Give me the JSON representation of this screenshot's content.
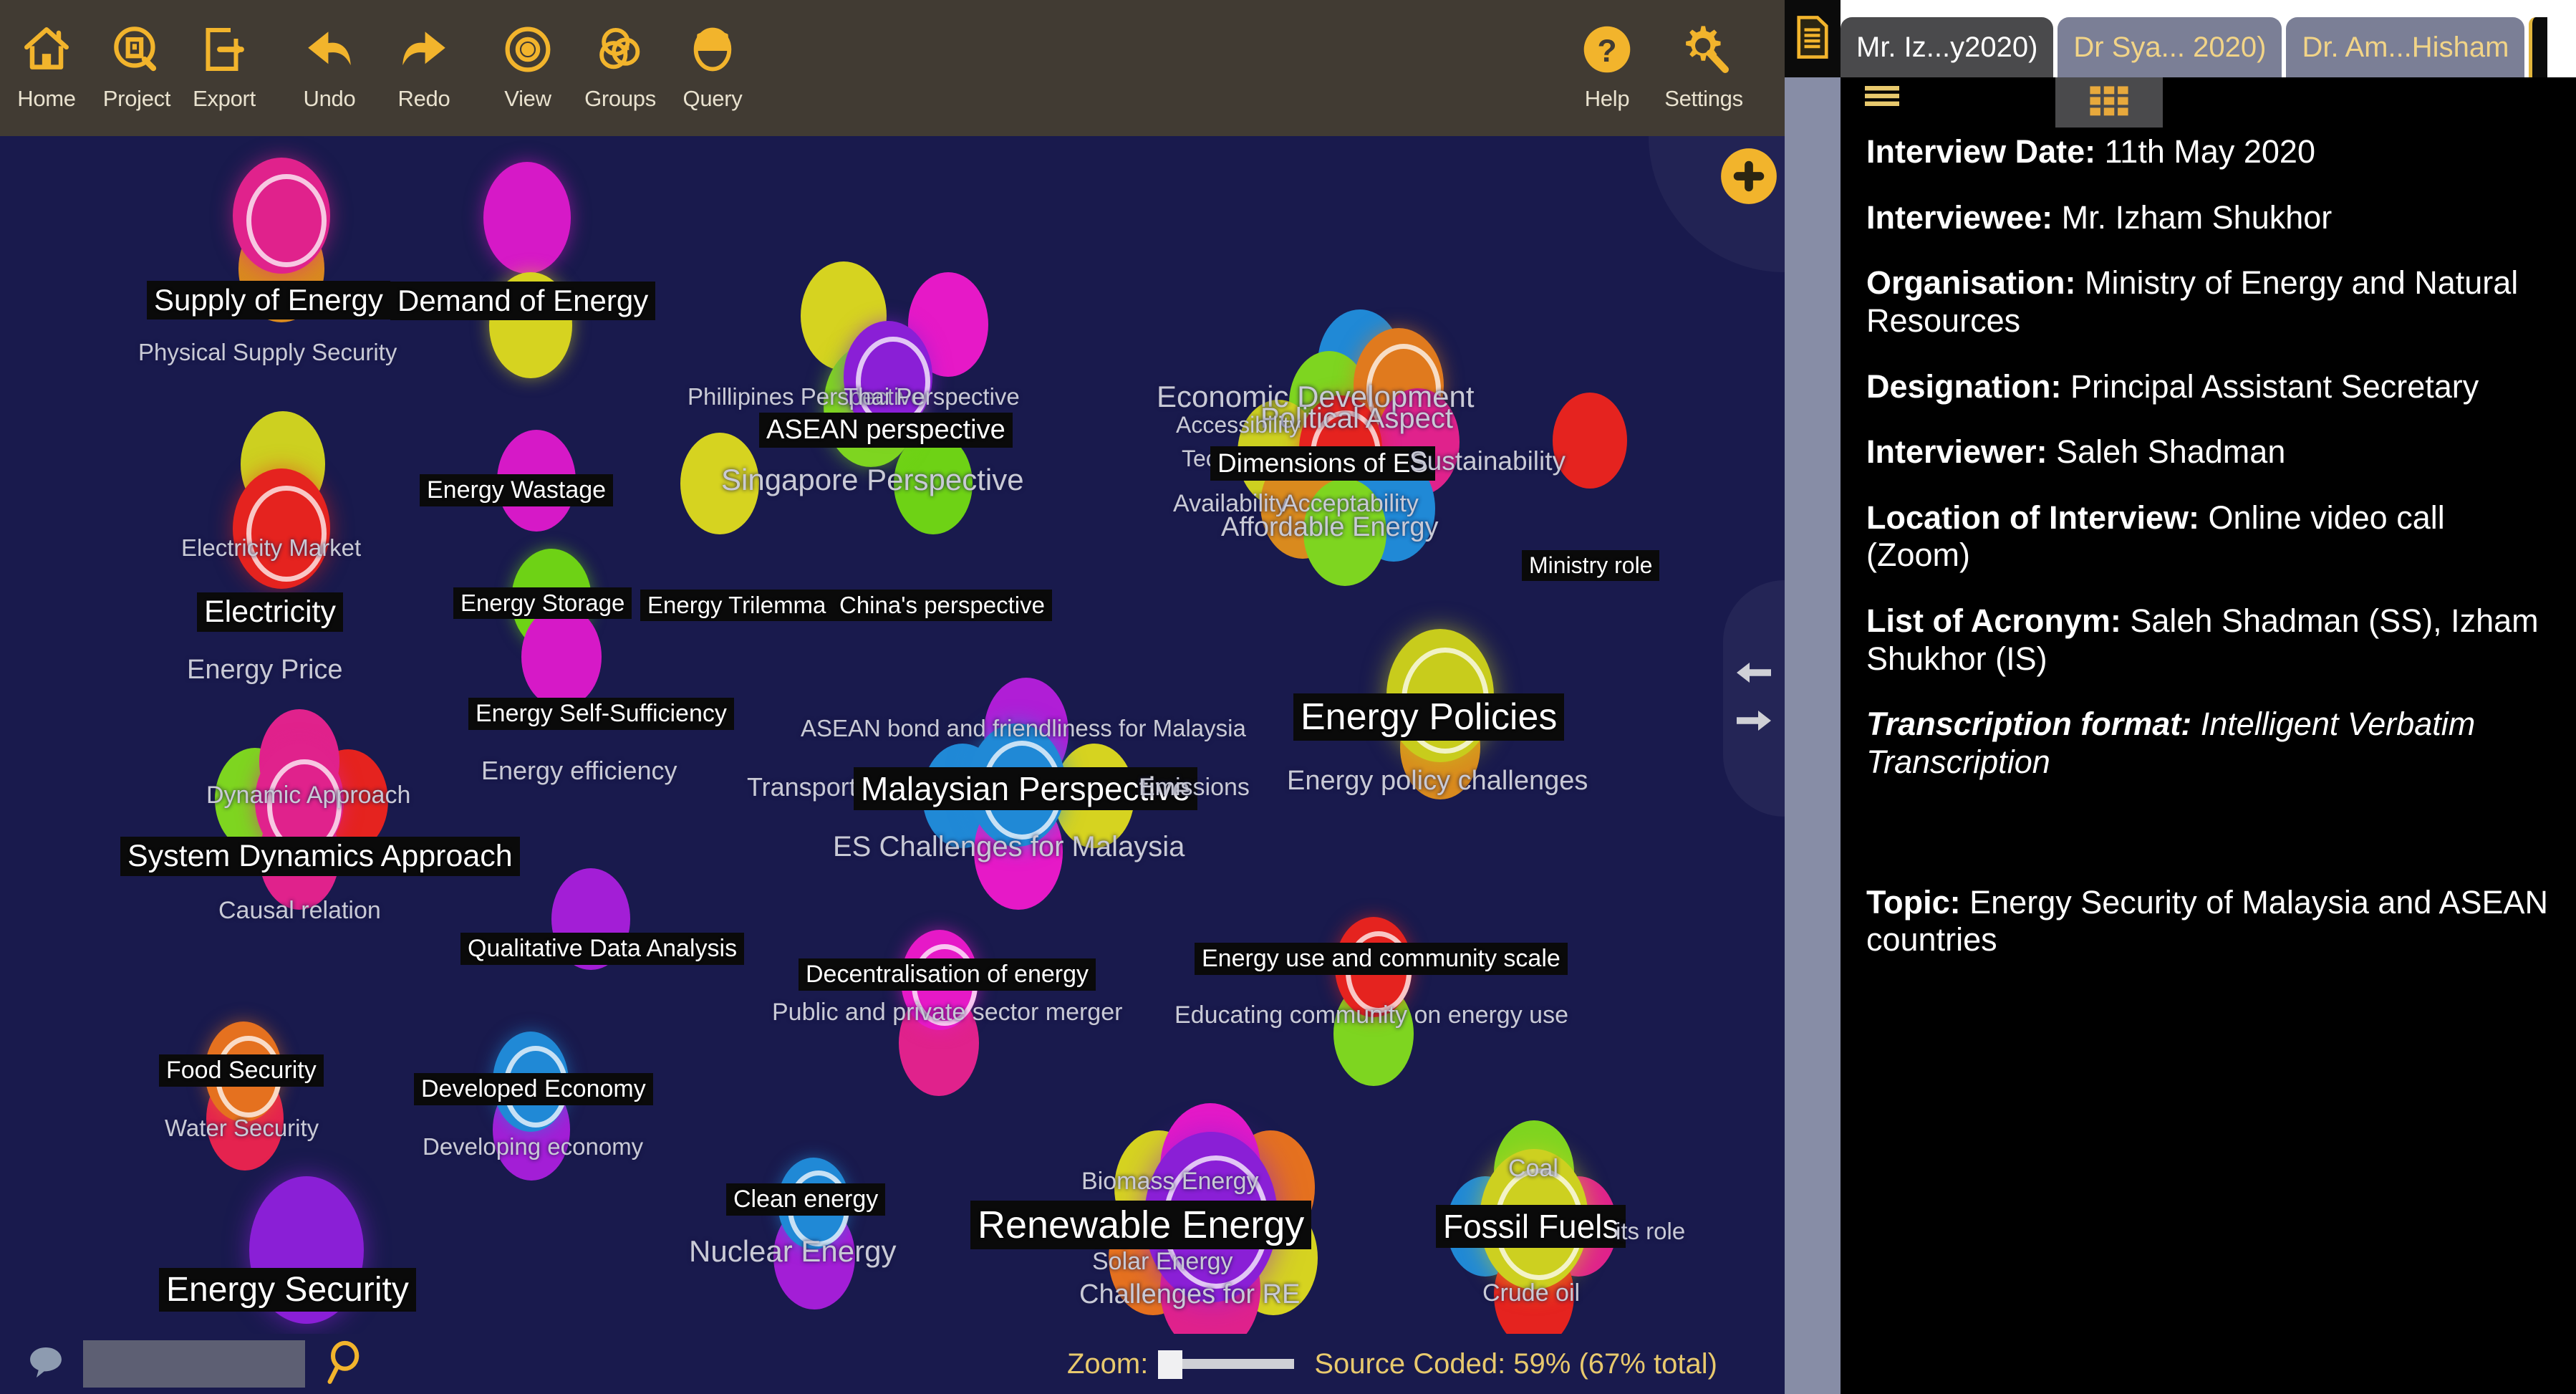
{
  "toolbar": {
    "left_items": [
      {
        "label": "Home",
        "icon": "home-icon"
      },
      {
        "label": "Project",
        "icon": "project-icon"
      },
      {
        "label": "Export",
        "icon": "export-icon"
      },
      {
        "label": "Undo",
        "icon": "undo-arrow-icon"
      },
      {
        "label": "Redo",
        "icon": "redo-arrow-icon"
      },
      {
        "label": "View",
        "icon": "view-eye-icon"
      },
      {
        "label": "Groups",
        "icon": "groups-icon"
      },
      {
        "label": "Query",
        "icon": "query-icon"
      }
    ],
    "right_items": [
      {
        "label": "Help",
        "icon": "help-question-icon"
      },
      {
        "label": "Settings",
        "icon": "settings-gear-icon"
      }
    ],
    "mini_icons": [
      {
        "icon": "cloud-icon"
      },
      {
        "icon": "magnifier-icon"
      }
    ]
  },
  "tabs": [
    {
      "label": "Mr. Iz...y2020)",
      "active": true
    },
    {
      "label": "Dr Sya... 2020)",
      "active": false
    },
    {
      "label": "Dr. Am...Hisham",
      "active": false
    }
  ],
  "canvas": {
    "nodes": [
      {
        "label": "Supply of Energy",
        "style": "boxed-big"
      },
      {
        "label": "Demand of Energy",
        "style": "boxed-big"
      },
      {
        "label": "Physical Supply Security",
        "style": "dim"
      },
      {
        "label": "Energy Wastage",
        "style": "boxed"
      },
      {
        "label": "Electricity Market",
        "style": "dim"
      },
      {
        "label": "Electricity",
        "style": "boxed-big"
      },
      {
        "label": "Energy Price",
        "style": "dim"
      },
      {
        "label": "Energy Storage",
        "style": "boxed"
      },
      {
        "label": "Energy Trilemma",
        "style": "boxed"
      },
      {
        "label": "China's perspective",
        "style": "boxed"
      },
      {
        "label": "Phillipines Perspective",
        "style": "dim"
      },
      {
        "label": "Thai Perspective",
        "style": "dim"
      },
      {
        "label": "ASEAN perspective",
        "style": "boxed"
      },
      {
        "label": "Singapore Perspective",
        "style": "dim"
      },
      {
        "label": "Economic Development",
        "style": "dim"
      },
      {
        "label": "Political Aspect",
        "style": "dim"
      },
      {
        "label": "Accessibility",
        "style": "dim"
      },
      {
        "label": "Technical",
        "style": "dim"
      },
      {
        "label": "Dimensions of ES",
        "style": "boxed"
      },
      {
        "label": "Sustainability",
        "style": "dim"
      },
      {
        "label": "Availability",
        "style": "dim"
      },
      {
        "label": "Acceptability",
        "style": "dim"
      },
      {
        "label": "Affordable Energy",
        "style": "dim"
      },
      {
        "label": "Ministry role",
        "style": "boxed"
      },
      {
        "label": "Energy Self-Sufficiency",
        "style": "boxed"
      },
      {
        "label": "Energy efficiency",
        "style": "dim"
      },
      {
        "label": "Energy Policies",
        "style": "boxed-big"
      },
      {
        "label": "Energy policy challenges",
        "style": "dim"
      },
      {
        "label": "ASEAN bond and friendliness for Malaysia",
        "style": "dim"
      },
      {
        "label": "Transport",
        "style": "dim"
      },
      {
        "label": "Malaysian Perspective",
        "style": "boxed-big"
      },
      {
        "label": "Emissions",
        "style": "dim"
      },
      {
        "label": "ES Challenges for Malaysia",
        "style": "dim"
      },
      {
        "label": "Dynamic Approach",
        "style": "dim"
      },
      {
        "label": "System Dynamics Approach",
        "style": "boxed-big"
      },
      {
        "label": "Causal relation",
        "style": "dim"
      },
      {
        "label": "Qualitative Data Analysis",
        "style": "boxed"
      },
      {
        "label": "Decentralisation of energy",
        "style": "boxed"
      },
      {
        "label": "Public and private sector merger",
        "style": "dim"
      },
      {
        "label": "Energy use and community scale",
        "style": "boxed"
      },
      {
        "label": "Educating community on energy use",
        "style": "dim"
      },
      {
        "label": "Food Security",
        "style": "boxed"
      },
      {
        "label": "Water Security",
        "style": "dim"
      },
      {
        "label": "Developed Economy",
        "style": "boxed"
      },
      {
        "label": "Developing economy",
        "style": "dim"
      },
      {
        "label": "Clean energy",
        "style": "boxed"
      },
      {
        "label": "Nuclear Energy",
        "style": "dim"
      },
      {
        "label": "Energy Security",
        "style": "boxed-big"
      },
      {
        "label": "Biomass Energy",
        "style": "dim"
      },
      {
        "label": "Renewable Energy",
        "style": "boxed-big"
      },
      {
        "label": "Solar Energy",
        "style": "dim"
      },
      {
        "label": "Challenges for RE",
        "style": "dim"
      },
      {
        "label": "Coal",
        "style": "dim"
      },
      {
        "label": "Fossil Fuels",
        "style": "boxed-big"
      },
      {
        "label": "its role",
        "style": "dim"
      },
      {
        "label": "Crude oil",
        "style": "dim"
      }
    ]
  },
  "statusbar": {
    "search_placeholder": "",
    "zoom_label": "Zoom:",
    "coded_text": "Source Coded: 59% (67% total)"
  },
  "panel": {
    "rows": [
      {
        "key": "Interview Date:",
        "value": " 11th May 2020"
      },
      {
        "key": "Interviewee:",
        "value": " Mr. Izham Shukhor"
      },
      {
        "key": "Organisation:",
        "value": " Ministry of Energy and Natural Resources"
      },
      {
        "key": "Designation:",
        "value": " Principal Assistant Secretary"
      },
      {
        "key": "Interviewer:",
        "value": " Saleh Shadman"
      },
      {
        "key": "Location of Interview:",
        "value": " Online video call (Zoom)"
      },
      {
        "key": "List of Acronym:",
        "value": " Saleh Shadman (SS), Izham Shukhor (IS)"
      }
    ],
    "transcription_key": "Transcription format:",
    "transcription_value": " Intelligent Verbatim Transcription",
    "topic_key": "Topic:",
    "topic_value": " Energy Security of Malaysia and ASEAN countries"
  },
  "colors": {
    "accent": "#f2b42c",
    "canvas_bg": "#191a4d",
    "toolbar_bg": "#413b33",
    "panel_bg": "#000000"
  }
}
